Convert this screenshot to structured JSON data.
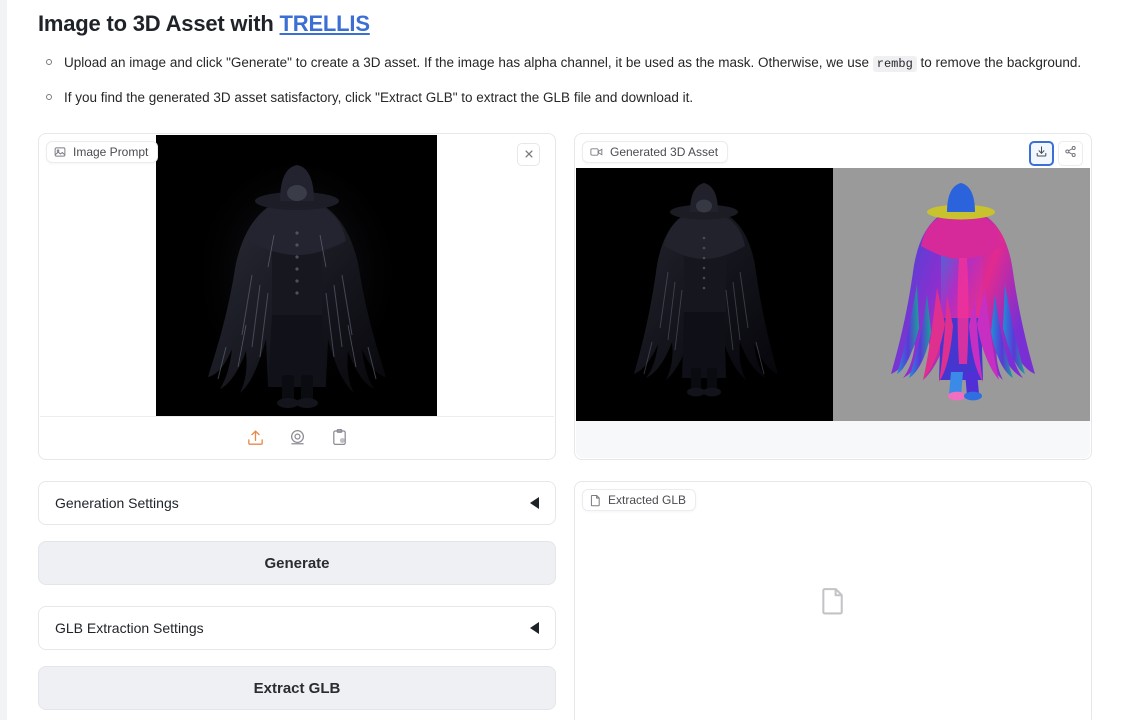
{
  "header": {
    "title_prefix": "Image to 3D Asset with ",
    "title_link": "TRELLIS",
    "bullets": [
      {
        "part1": "Upload an image and click \"Generate\" to create a 3D asset. If the image has alpha channel, it be used as the mask. Otherwise, we use ",
        "code": "rembg",
        "part2": " to remove the background."
      },
      {
        "part1": "If you find the generated 3D asset satisfactory, click \"Extract GLB\" to extract the GLB file and download it.",
        "code": "",
        "part2": ""
      }
    ]
  },
  "left_column": {
    "image_prompt": {
      "label": "Image Prompt",
      "label_icon": "image-icon",
      "clear_icon": "close-icon",
      "tools": [
        {
          "icon": "upload-icon",
          "name": "upload-button"
        },
        {
          "icon": "webcam-icon",
          "name": "webcam-button"
        },
        {
          "icon": "clipboard-paste-icon",
          "name": "paste-button"
        }
      ]
    },
    "generation_settings": {
      "label": "Generation Settings",
      "caret": "caret-left-icon",
      "expanded": false
    },
    "generate_button": "Generate",
    "glb_settings": {
      "label": "GLB Extraction Settings",
      "caret": "caret-left-icon",
      "expanded": false
    },
    "extract_button": "Extract GLB"
  },
  "right_column": {
    "generated_asset": {
      "label": "Generated 3D Asset",
      "label_icon": "video-icon",
      "actions": [
        {
          "name": "download-button",
          "icon": "download-icon",
          "focused": true
        },
        {
          "name": "share-button",
          "icon": "share-icon",
          "focused": false
        }
      ]
    },
    "extracted_glb": {
      "label": "Extracted GLB",
      "label_icon": "file-icon",
      "placeholder_icon": "file-icon",
      "empty": true
    }
  },
  "colors": {
    "link": "#3b6fd4",
    "focus_ring": "#3b6fd4",
    "upload_icon": "#e8884a",
    "button_bg": "#eef0f3",
    "panel_border": "#e5e7eb",
    "asset_bg_left": "#000000",
    "asset_bg_right": "#9a9a9a"
  }
}
